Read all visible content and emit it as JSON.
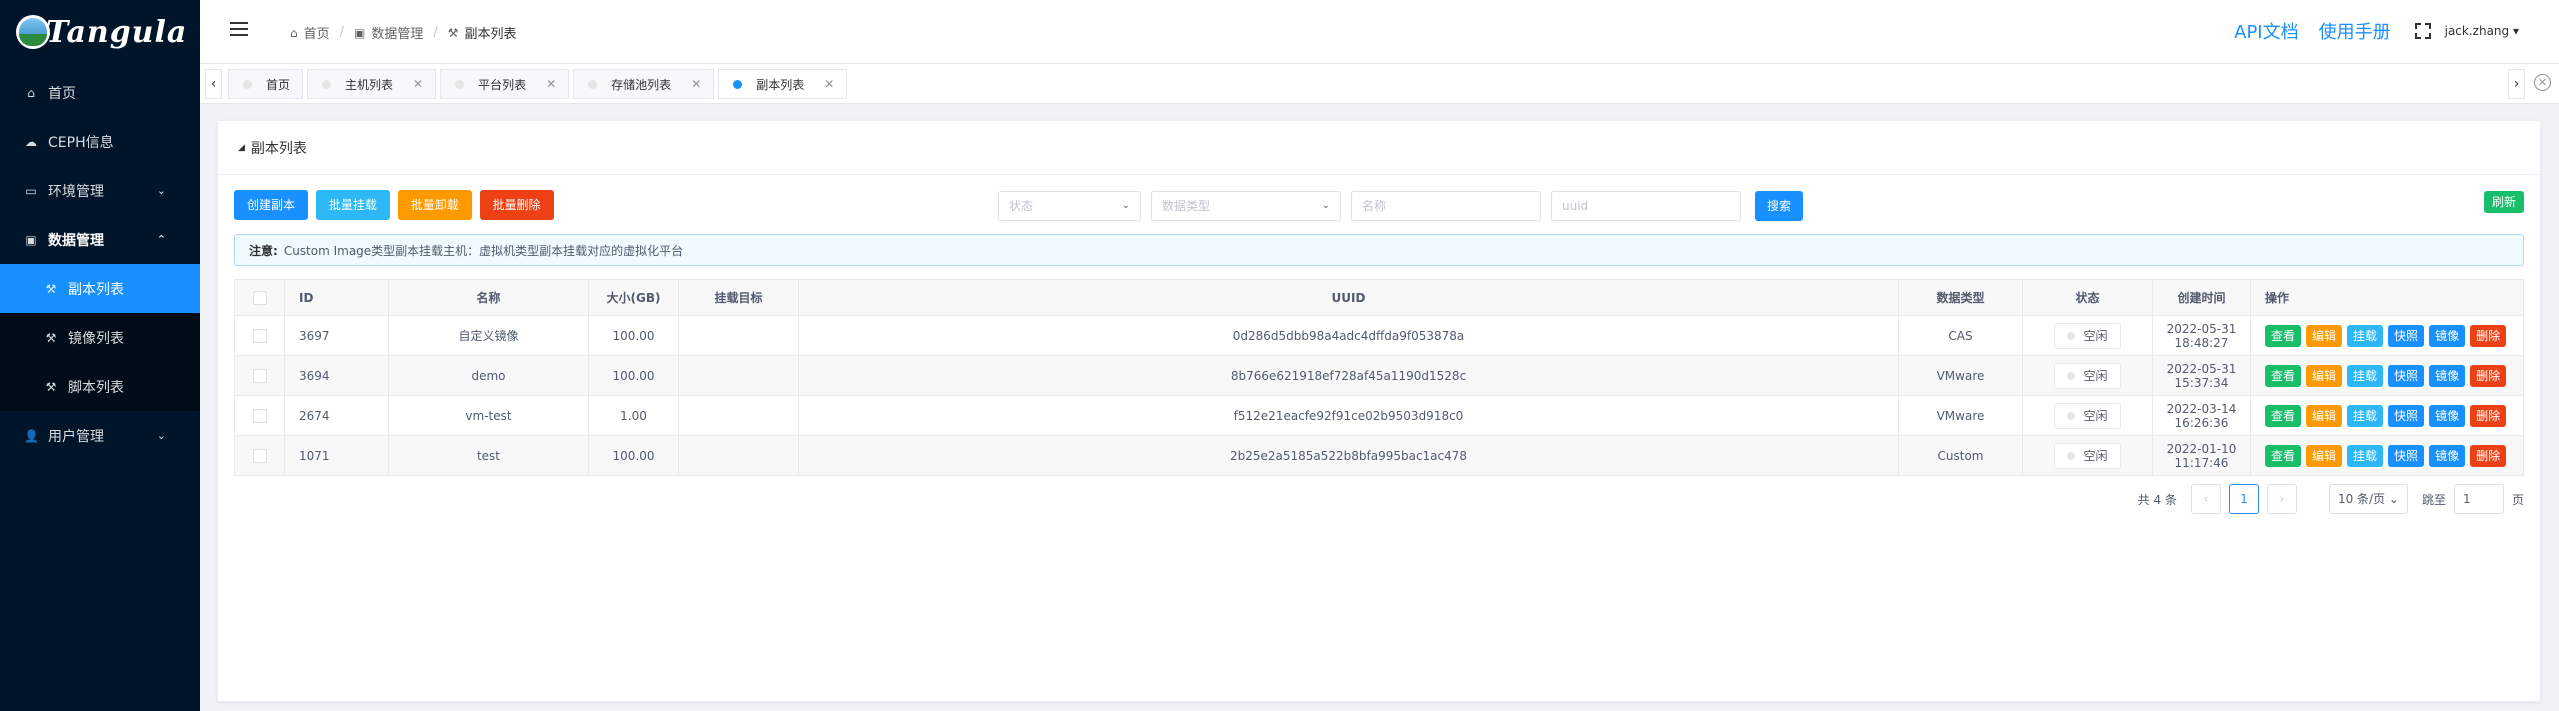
{
  "app": {
    "logo_text": "Tangula"
  },
  "sidebar": {
    "items": [
      {
        "label": "首页",
        "icon": "home-icon"
      },
      {
        "label": "CEPH信息",
        "icon": "cloud-icon"
      },
      {
        "label": "环境管理",
        "icon": "monitor-icon"
      },
      {
        "label": "数据管理",
        "icon": "lock-icon"
      },
      {
        "label": "用户管理",
        "icon": "users-icon"
      }
    ],
    "sub_items": [
      {
        "label": "副本列表",
        "active": true
      },
      {
        "label": "镜像列表"
      },
      {
        "label": "脚本列表"
      }
    ]
  },
  "header": {
    "breadcrumb": [
      "首页",
      "数据管理",
      "副本列表"
    ],
    "api_doc": "API文档",
    "manual": "使用手册",
    "user": "jack.zhang"
  },
  "tabs": [
    "首页",
    "主机列表",
    "平台列表",
    "存储池列表",
    "副本列表"
  ],
  "card": {
    "title": "副本列表"
  },
  "toolbar": {
    "create": "创建副本",
    "batch_mount": "批量挂载",
    "batch_unmount": "批量卸载",
    "batch_delete": "批量删除",
    "refresh": "刷新"
  },
  "filters": {
    "status_placeholder": "状态",
    "type_placeholder": "数据类型",
    "name_placeholder": "名称",
    "uuid_placeholder": "uuid",
    "search": "搜索"
  },
  "notice": {
    "label": "注意:",
    "text": "Custom Image类型副本挂载主机：虚拟机类型副本挂载对应的虚拟化平台"
  },
  "table": {
    "headers": [
      "ID",
      "名称",
      "大小(GB)",
      "挂载目标",
      "UUID",
      "数据类型",
      "状态",
      "创建时间",
      "操作"
    ],
    "rows": [
      {
        "id": "3697",
        "name": "自定义镜像",
        "size": "100.00",
        "target": "",
        "uuid": "0d286d5dbb98a4adc4dffda9f053878a",
        "type": "CAS",
        "status": "空闲",
        "date": "2022-05-31",
        "time": "18:48:27"
      },
      {
        "id": "3694",
        "name": "demo",
        "size": "100.00",
        "target": "",
        "uuid": "8b766e621918ef728af45a1190d1528c",
        "type": "VMware",
        "status": "空闲",
        "date": "2022-05-31",
        "time": "15:37:34"
      },
      {
        "id": "2674",
        "name": "vm-test",
        "size": "1.00",
        "target": "",
        "uuid": "f512e21eacfe92f91ce02b9503d918c0",
        "type": "VMware",
        "status": "空闲",
        "date": "2022-03-14",
        "time": "16:26:36"
      },
      {
        "id": "1071",
        "name": "test",
        "size": "100.00",
        "target": "",
        "uuid": "2b25e2a5185a522b8bfa995bac1ac478",
        "type": "Custom",
        "status": "空闲",
        "date": "2022-01-10",
        "time": "11:17:46"
      }
    ],
    "ops": [
      "查看",
      "编辑",
      "挂载",
      "快照",
      "镜像",
      "删除"
    ]
  },
  "pagination": {
    "total": "共 4 条",
    "page": "1",
    "page_size": "10 条/页",
    "jump_label": "跳至",
    "jump_value": "1",
    "page_suffix": "页"
  }
}
